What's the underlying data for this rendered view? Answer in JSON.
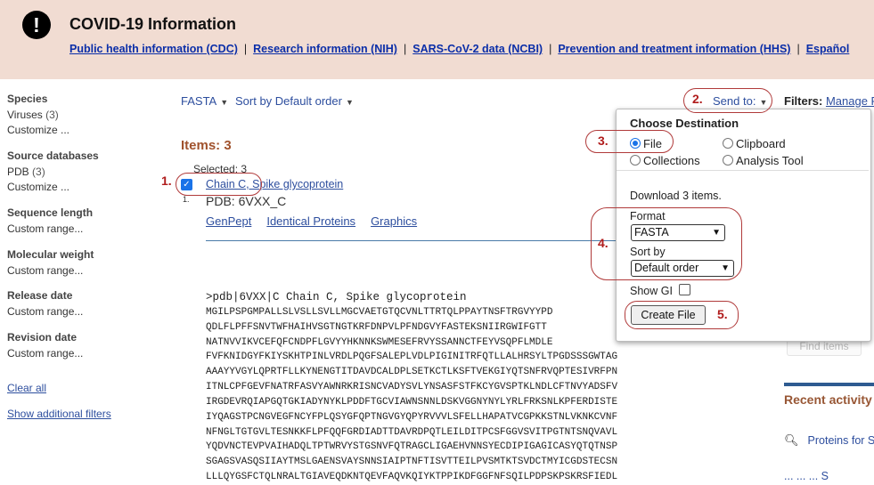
{
  "banner": {
    "title": "COVID-19 Information",
    "alert_icon": "exclamation-icon",
    "links": [
      "Public health information (CDC)",
      "Research information (NIH)",
      "SARS-CoV-2 data (NCBI)",
      "Prevention and treatment information (HHS)",
      "Español"
    ],
    "separator": "|"
  },
  "facets": [
    {
      "title": "Species",
      "items": [
        {
          "label": "Viruses",
          "count": "(3)"
        },
        {
          "label": "Customize ...",
          "count": ""
        }
      ]
    },
    {
      "title": "Source databases",
      "items": [
        {
          "label": "PDB",
          "count": "(3)"
        },
        {
          "label": "Customize ...",
          "count": ""
        }
      ]
    },
    {
      "title": "Sequence length",
      "items": [
        {
          "label": "Custom range...",
          "count": ""
        }
      ]
    },
    {
      "title": "Molecular weight",
      "items": [
        {
          "label": "Custom range...",
          "count": ""
        }
      ]
    },
    {
      "title": "Release date",
      "items": [
        {
          "label": "Custom range...",
          "count": ""
        }
      ]
    },
    {
      "title": "Revision date",
      "items": [
        {
          "label": "Custom range...",
          "count": ""
        }
      ]
    }
  ],
  "facet_links": {
    "clear_all": "Clear all",
    "show_additional": "Show additional filters"
  },
  "display": {
    "format": "FASTA",
    "sort": "Sort by Default order"
  },
  "results": {
    "items_count": "Items: 3",
    "selected": "Selected: 3",
    "item_number": "1.",
    "title": "Chain C, Spike glycoprotein",
    "accession": "PDB: 6VXX_C",
    "links": [
      "GenPept",
      "Identical Proteins",
      "Graphics"
    ]
  },
  "sequence": {
    "header": ">pdb|6VXX|C Chain C, Spike glycoprotein",
    "lines": [
      "MGILPSPGMPALLSLVSLLSVLLMGCVAETGTQCVNLTTRTQLPPAYTNSFTRGVYYPD",
      "QDLFLPFFSNVTWFHAIHVSGTNGTKRFDNPVLPFNDGVYFASTEKSNIIRGWIFGTT",
      "NATNVVIKVCEFQFCNDPFLGVYYHKNNKSWMESEFRVYSSANNCTFEYVSQPFLMDLE",
      "FVFKNIDGYFKIYSKHTPINLVRDLPQGFSALEPLVDLPIGINITRFQTLLALHRSYLTPGDSSSGWTAG",
      "AAAYYVGYLQPRTFLLKYNENGTITDAVDCALDPLSETKCTLKSFTVEKGIYQTSNFRVQPTESIVRFPN",
      "ITNLCPFGEVFNATRFASVYAWNRKRISNCVADYSVLYNSASFSTFKCYGVSPTKLNDLCFTNVYADSFV",
      "IRGDEVRQIAPGQTGKIADYNYKLPDDFTGCVIAWNSNNLDSKVGGNYNYLYRLFRKSNLKPFERDISTE",
      "IYQAGSTPCNGVEGFNCYFPLQSYGFQPTNGVGYQPYRVVVLSFELLHAPATVCGPKKSTNLVKNKCVNF",
      "NFNGLTGTGVLTESNKKFLPFQQFGRDIADTTDAVRDPQTLEILDITPCSFGGVSVITPGTNTSNQVAVL",
      "YQDVNCTEVPVAIHADQLTPTWRVYSTGSNVFQTRAGCLIGAEHVNNSYECDIPIGAGICASYQTQTNSP",
      "SGAGSVASQSIIAYTMSLGAENSVAYSNNSIAIPTNFTISVTTEILPVSMTKTSVDCTMYICGDSTECSN",
      "LLLQYGSFCTQLNRALTGIAVEQDKNTQEVFAQVKQIYKTPPIKDFGGFNFSQILPDPSKPSKRSFIEDL"
    ]
  },
  "right": {
    "send_to": "Send to:",
    "filters_label": "Filters:",
    "filters_link": "Manage F",
    "find_items": "Find items",
    "recent_title": "Recent activity",
    "recent_item": "Proteins for S",
    "recent_item2": "... ... ... S"
  },
  "popup": {
    "title": "Choose Destination",
    "destinations": [
      {
        "label": "File",
        "selected": true
      },
      {
        "label": "Clipboard",
        "selected": false
      },
      {
        "label": "Collections",
        "selected": false
      },
      {
        "label": "Analysis Tool",
        "selected": false
      }
    ],
    "download_text": "Download 3 items.",
    "format_label": "Format",
    "format_value": "FASTA",
    "sort_label": "Sort by",
    "sort_value": "Default order",
    "show_gi_label": "Show GI",
    "show_gi_checked": false,
    "create_button": "Create File"
  },
  "annotations": [
    "1.",
    "2.",
    "3.",
    "4.",
    "5."
  ],
  "colors": {
    "banner_bg": "#f1dcd2",
    "link": "#2d4e9e",
    "annotation": "#b01c1c",
    "items_heading": "#a0522d"
  }
}
